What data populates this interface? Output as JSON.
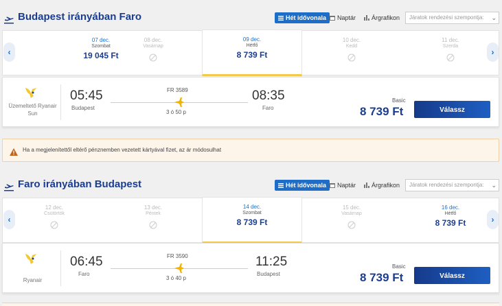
{
  "outbound": {
    "title": "Budapest irányában Faro",
    "tabs": {
      "timeline": "Hét idővonala",
      "calendar": "Naptár",
      "chart": "Árgrafikon"
    },
    "sort_placeholder": "Járatok rendezési szempontja:",
    "dates": [
      {
        "date": "07 dec.",
        "day": "Szombat",
        "price": "19 045 Ft"
      },
      {
        "date": "08 dec.",
        "day": "Vasárnap",
        "price": ""
      },
      {
        "date": "09 dec.",
        "day": "Hétfő",
        "price": "8 739 Ft"
      },
      {
        "date": "10 dec.",
        "day": "Kedd",
        "price": ""
      },
      {
        "date": "11 dec.",
        "day": "Szerda",
        "price": ""
      }
    ],
    "flight": {
      "operator": "Üzemeltető Ryanair Sun",
      "dep_time": "05:45",
      "dep_city": "Budapest",
      "arr_time": "08:35",
      "arr_city": "Faro",
      "flight_no": "FR 3589",
      "duration": "3 ó 50 p",
      "fare_type": "Basic",
      "price": "8 739 Ft",
      "button": "Válassz"
    }
  },
  "notice": "Ha a megjelenítettől eltérő pénznemben vezetett kártyával fizet, az ár módosulhat",
  "return": {
    "title": "Faro irányában Budapest",
    "tabs": {
      "timeline": "Hét idővonala",
      "calendar": "Naptár",
      "chart": "Árgrafikon"
    },
    "sort_placeholder": "Járatok rendezési szempontja:",
    "dates": [
      {
        "date": "12 dec.",
        "day": "Csütörtök",
        "price": ""
      },
      {
        "date": "13 dec.",
        "day": "Péntek",
        "price": ""
      },
      {
        "date": "14 dec.",
        "day": "Szombat",
        "price": "8 739 Ft"
      },
      {
        "date": "15 dec.",
        "day": "Vasárnap",
        "price": ""
      },
      {
        "date": "16 dec.",
        "day": "Hétfő",
        "price": "8 739 Ft"
      }
    ],
    "flight": {
      "operator": "Ryanair",
      "dep_time": "06:45",
      "dep_city": "Faro",
      "arr_time": "11:25",
      "arr_city": "Budapest",
      "flight_no": "FR 3590",
      "duration": "3 ó 40 p",
      "fare_type": "Basic",
      "price": "8 739 Ft",
      "button": "Válassz"
    }
  },
  "colors": {
    "brand": "#1b3d8f",
    "accent": "#1e6ec8",
    "selected_underline": "#f2c94c",
    "notice_bg": "#fdf4ea"
  }
}
